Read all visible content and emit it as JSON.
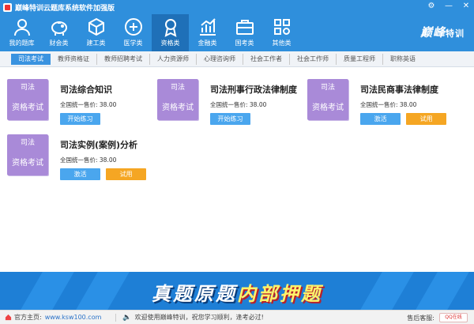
{
  "window": {
    "title": "巅峰特训云题库系统软件加强版",
    "controls": [
      "⚙",
      "—",
      "✕"
    ]
  },
  "nav": [
    {
      "label": "我的题库",
      "icon": "user-icon"
    },
    {
      "label": "财会类",
      "icon": "piggy-bank-icon"
    },
    {
      "label": "建工类",
      "icon": "cube-icon"
    },
    {
      "label": "医学类",
      "icon": "medical-cross-icon"
    },
    {
      "label": "资格类",
      "icon": "certificate-icon",
      "active": true
    },
    {
      "label": "金融类",
      "icon": "bar-chart-icon"
    },
    {
      "label": "国考类",
      "icon": "briefcase-icon"
    },
    {
      "label": "其他类",
      "icon": "apps-icon"
    }
  ],
  "brand": {
    "name": "巅峰",
    "suffix": "特训"
  },
  "tabs": [
    "司法考试",
    "教师资格证",
    "教师招聘考试",
    "人力资源师",
    "心理咨询师",
    "社会工作者",
    "社会工作师",
    "质量工程师",
    "职称英语"
  ],
  "cards": [
    {
      "badge_top": "司法",
      "badge_bottom": "资格考试",
      "title": "司法综合知识",
      "price": "全国统一售价:   38.00",
      "btn1": "开始练习",
      "btn2": ""
    },
    {
      "badge_top": "司法",
      "badge_bottom": "资格考试",
      "title": "司法刑事行政法律制度",
      "price": "全国统一售价:   38.00",
      "btn1": "开始练习",
      "btn2": ""
    },
    {
      "badge_top": "司法",
      "badge_bottom": "资格考试",
      "title": "司法民商事法律制度",
      "price": "全国统一售价:   38.00",
      "btn1": "激活",
      "btn2": "试用"
    },
    {
      "badge_top": "司法",
      "badge_bottom": "资格考试",
      "title": "司法实例(案例)分析",
      "price": "全国统一售价:   38.00",
      "btn1": "激活",
      "btn2": "试用"
    }
  ],
  "banner": {
    "part1": "真题原题",
    "part2": "内部押题"
  },
  "status": {
    "home_label": "官方主页:",
    "url": "www.ksw100.com",
    "message": "欢迎使用巅峰特训，祝您学习顺利，逢考必过!",
    "support": "售后客服:",
    "qq": "QQ在线"
  },
  "colors": {
    "header": "#2f8fdc",
    "badge": "#a98ad8",
    "button_blue": "#4aa6ee",
    "button_orange": "#f5a623"
  }
}
